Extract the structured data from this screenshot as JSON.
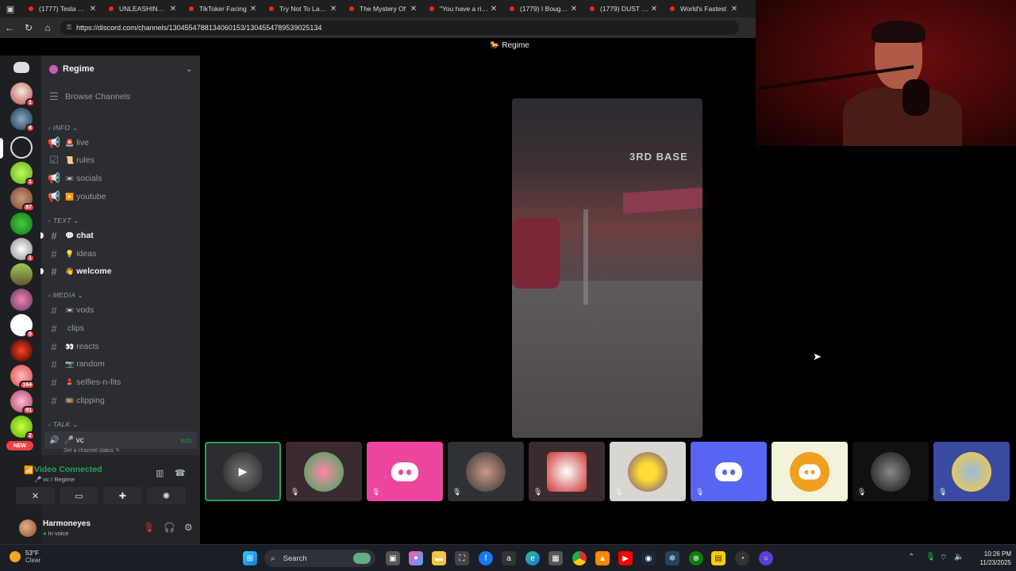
{
  "browser": {
    "tabs": [
      {
        "title": "(1777) Tesla Glui"
      },
      {
        "title": "UNLEASHING our"
      },
      {
        "title": "TikToker Facing"
      },
      {
        "title": "Try Not To Laugh"
      },
      {
        "title": "The Mystery Of"
      },
      {
        "title": "\"You have a right"
      },
      {
        "title": "(1779) I Bought a"
      },
      {
        "title": "(1779) DUST - Yo"
      },
      {
        "title": "World's Fastest"
      }
    ],
    "url": "https://discord.com/channels/1304554788134060153/1304554789539025134"
  },
  "discord": {
    "guild_name": "Regime",
    "browse_channels": "Browse Channels",
    "server_badges": [
      "1",
      "4",
      "",
      "1",
      "97",
      "",
      "1",
      "",
      "",
      "5",
      "",
      "164",
      "91",
      "2"
    ],
    "new_label": "NEW",
    "categories": {
      "info": "INFO",
      "text": "TEXT",
      "media": "MEDIA",
      "talk": "TALK"
    },
    "info_channels": [
      {
        "emoji": "🚨",
        "name": "live"
      },
      {
        "emoji": "📜",
        "name": "rules"
      },
      {
        "emoji": "📼",
        "name": "socials"
      },
      {
        "emoji": "▶️",
        "name": "youtube"
      }
    ],
    "text_channels": [
      {
        "emoji": "💬",
        "name": "chat"
      },
      {
        "emoji": "💡",
        "name": "ideas"
      },
      {
        "emoji": "👋",
        "name": "welcome"
      }
    ],
    "media_channels": [
      {
        "emoji": "📼",
        "name": "vods"
      },
      {
        "emoji": "",
        "name": "clips"
      },
      {
        "emoji": "👀",
        "name": "reacts"
      },
      {
        "emoji": "📷",
        "name": "random"
      },
      {
        "emoji": "💄",
        "name": "selfies-n-fits"
      },
      {
        "emoji": "🎞️",
        "name": "clipping"
      }
    ],
    "voice_channel": {
      "name": "vc",
      "time": "9:01",
      "status_placeholder": "Set a channel status"
    },
    "voice_panel": {
      "title": "Video Connected",
      "subtitle": "vc / Regime"
    },
    "user": {
      "name": "Harmoneyes",
      "status": "In voice"
    },
    "stage_title": "Regime",
    "video_sign_text": "3RD BASE",
    "participant_count": 10
  },
  "taskbar": {
    "weather_temp": "53°F",
    "weather_cond": "Clear",
    "search_label": "Search",
    "time": "10:26 PM",
    "date": "11/23/2025"
  },
  "colors": {
    "discord_blurple": "#5865f2",
    "discord_pink": "#eb459e",
    "discord_green": "#23a55a",
    "discord_red": "#f23f43",
    "discord_orange": "#f0a020"
  }
}
